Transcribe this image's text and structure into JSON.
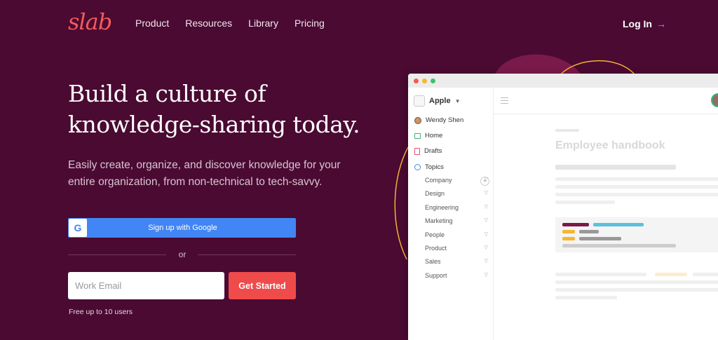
{
  "logo": "slab",
  "nav": {
    "items": [
      "Product",
      "Resources",
      "Library",
      "Pricing"
    ],
    "login": "Log In",
    "login_arrow": "→"
  },
  "hero": {
    "title_line1": "Build a culture of",
    "title_line2": "knowledge-sharing today.",
    "subtitle": "Easily create, organize, and discover knowledge for your entire organization, from non-technical to tech-savvy."
  },
  "signup": {
    "google_label": "Sign up with Google",
    "google_icon": "G",
    "or": "or",
    "email_placeholder": "Work Email",
    "cta": "Get Started",
    "note": "Free up to 10 users"
  },
  "app": {
    "workspace": "Apple",
    "user": "Wendy Shen",
    "home": "Home",
    "drafts": "Drafts",
    "topics_label": "Topics",
    "topics": [
      "Company",
      "Design",
      "Engineering",
      "Marketing",
      "People",
      "Product",
      "Sales",
      "Support"
    ],
    "doc_title": "Employee handbook"
  },
  "colors": {
    "background": "#4a0a32",
    "accent": "#ef4b4b",
    "google": "#4285f4",
    "link_arrow": "#5fc3f0"
  }
}
